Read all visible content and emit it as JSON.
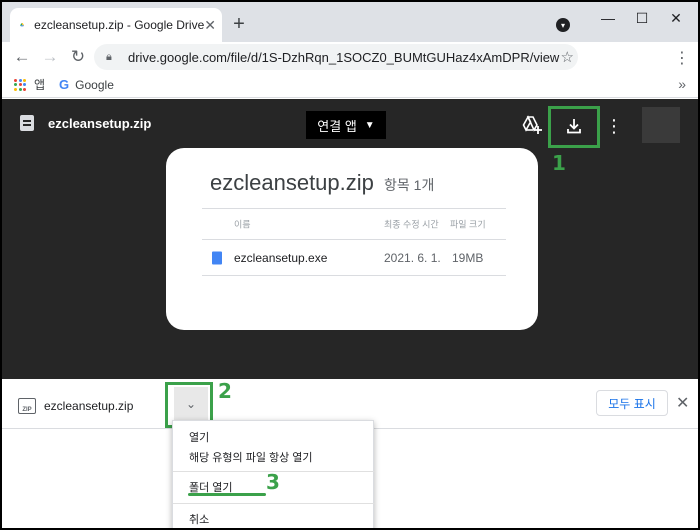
{
  "browser": {
    "tab_title": "ezcleansetup.zip - Google Drive",
    "tab_close": "✕",
    "new_tab": "+",
    "url": "drive.google.com/file/d/1S-DzhRqn_1SOCZ0_BUMtGUHaz4xAmDPR/view",
    "bookmarks": [
      {
        "label": "앱",
        "icon": "apps-grid-icon"
      },
      {
        "label": "Google",
        "icon": "google-g-icon"
      }
    ],
    "window_controls": [
      "—",
      "☐",
      "✕"
    ]
  },
  "drive": {
    "filename": "ezcleansetup.zip",
    "open_with_label": "연결 앱",
    "card": {
      "title": "ezcleansetup.zip",
      "count": "항목 1개",
      "columns": [
        "이름",
        "최종 수정 시간",
        "파일 크기"
      ],
      "rows": [
        {
          "name": "ezcleansetup.exe",
          "modified": "2021. 6. 1.",
          "size": "19MB"
        }
      ]
    }
  },
  "annotations": {
    "step1": "1",
    "step2": "2",
    "step3": "3",
    "highlight_color": "#3ba14a"
  },
  "download_bar": {
    "zip_badge": "ZIP",
    "filename": "ezcleansetup.zip",
    "show_all_label": "모두 표시",
    "close": "✕"
  },
  "context_menu": {
    "items": [
      "열기",
      "해당 유형의 파일 항상 열기",
      "폴더 열기",
      "취소"
    ]
  }
}
